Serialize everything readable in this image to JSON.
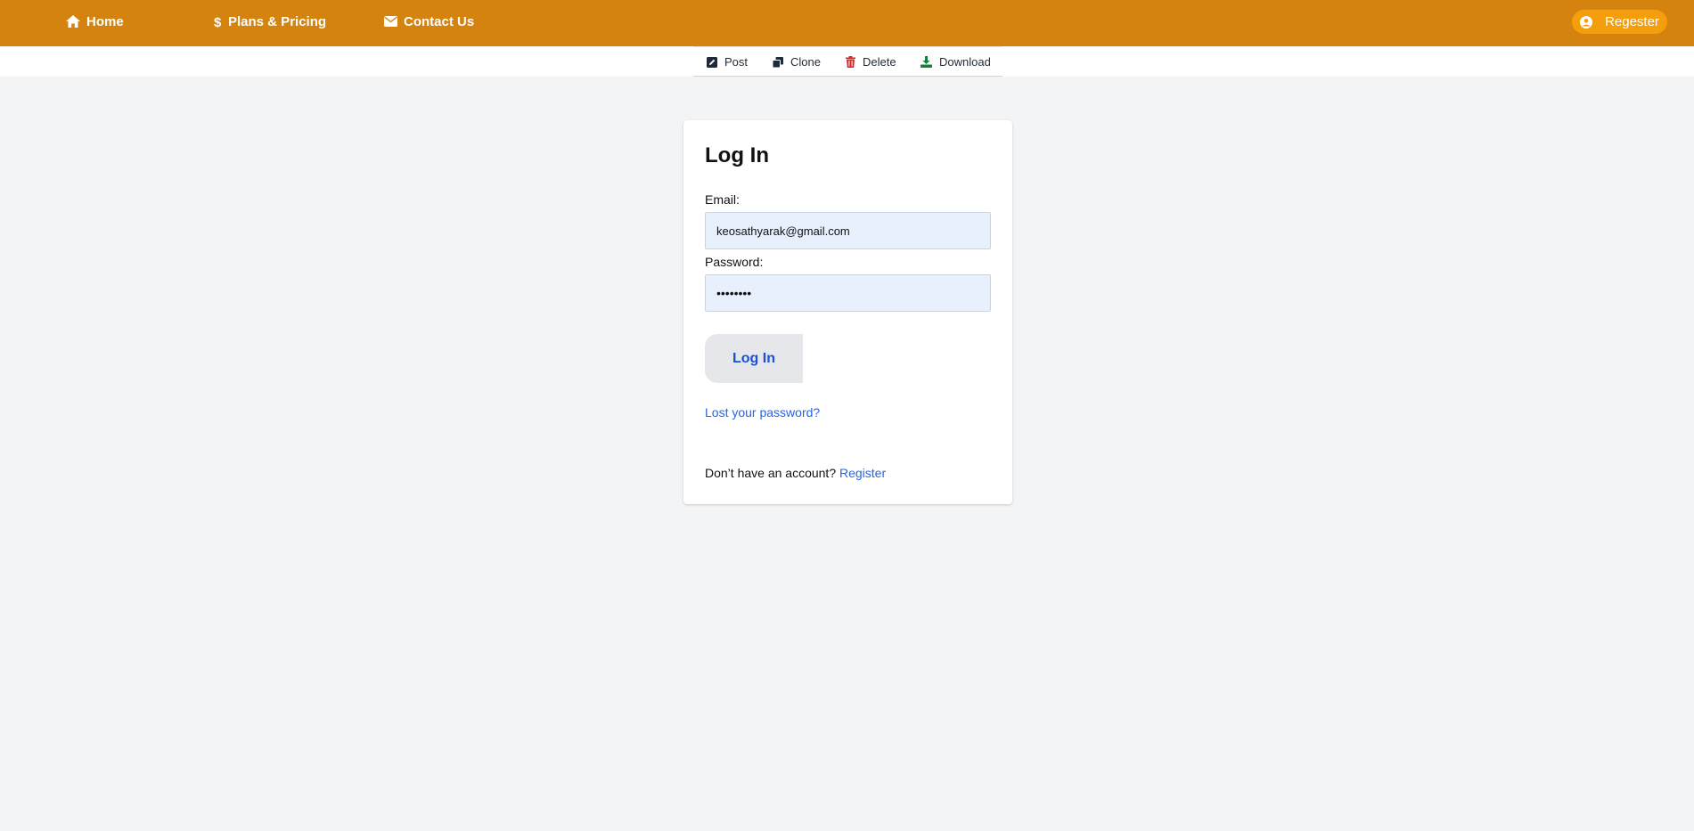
{
  "nav": {
    "home_label": "Home",
    "pricing_label": "Plans & Pricing",
    "contact_label": "Contact Us",
    "register_label": "Regester",
    "icons": {
      "home": "home-icon",
      "pricing": "dollar-icon",
      "contact": "envelope-icon",
      "register": "user-circle-icon"
    }
  },
  "toolbar": {
    "post_label": "Post",
    "clone_label": "Clone",
    "delete_label": "Delete",
    "download_label": "Download",
    "icons": {
      "post": "edit-icon",
      "clone": "clone-icon",
      "delete": "trash-icon",
      "download": "download-icon"
    }
  },
  "login": {
    "title": "Log In",
    "email_label": "Email:",
    "email_value": "keosathyarak@gmail.com",
    "password_label": "Password:",
    "password_value": "••••••••",
    "submit_label": "Log In",
    "lost_password_label": "Lost your password?",
    "no_account_text": "Don’t have an account?",
    "register_link_label": "Register"
  },
  "colors": {
    "brand": "#d4830e",
    "register_button": "#f59e0b",
    "link": "#2563eb",
    "input_bg": "#e8f0fe",
    "delete_icon": "#dc2626",
    "download_icon": "#15803d"
  }
}
